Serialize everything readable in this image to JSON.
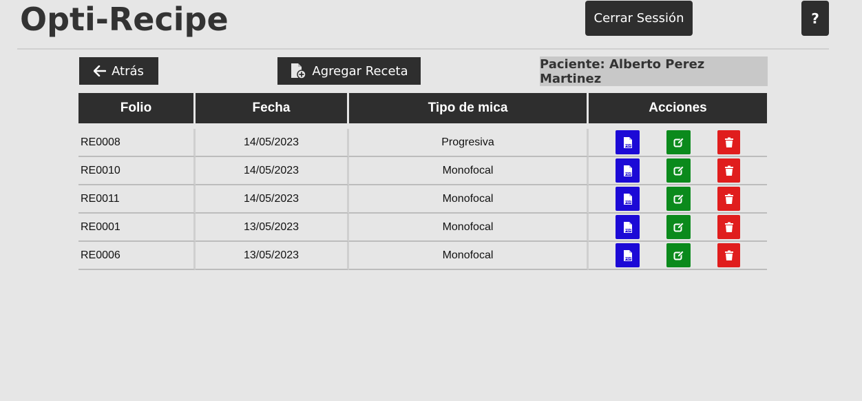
{
  "app": {
    "title": "Opti-Recipe"
  },
  "header": {
    "logout_label": "Cerrar Sessión",
    "help_label": "?"
  },
  "toolbar": {
    "back_label": "Atrás",
    "add_label": "Agregar Receta",
    "patient_label": "Paciente: Alberto Perez Martinez"
  },
  "table": {
    "columns": [
      "Folio",
      "Fecha",
      "Tipo de mica",
      "Acciones"
    ],
    "rows": [
      {
        "folio": "RE0008",
        "fecha": "14/05/2023",
        "tipo": "Progresiva"
      },
      {
        "folio": "RE0010",
        "fecha": "14/05/2023",
        "tipo": "Monofocal"
      },
      {
        "folio": "RE0011",
        "fecha": "14/05/2023",
        "tipo": "Monofocal"
      },
      {
        "folio": "RE0001",
        "fecha": "13/05/2023",
        "tipo": "Monofocal"
      },
      {
        "folio": "RE0006",
        "fecha": "13/05/2023",
        "tipo": "Monofocal"
      }
    ],
    "action_icons": [
      "pdf-icon",
      "edit-icon",
      "trash-icon"
    ]
  },
  "colors": {
    "pdf": "#1c0ad6",
    "edit": "#0b8a1c",
    "delete": "#e01d1d",
    "dark": "#2e2e2e"
  }
}
